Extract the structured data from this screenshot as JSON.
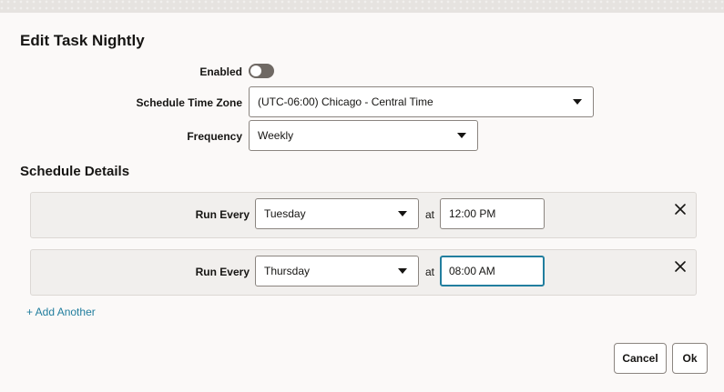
{
  "dialog": {
    "title": "Edit Task Nightly"
  },
  "form": {
    "enabled_label": "Enabled",
    "enabled_value": false,
    "timezone_label": "Schedule Time Zone",
    "timezone_value": "(UTC-06:00) Chicago - Central Time",
    "frequency_label": "Frequency",
    "frequency_value": "Weekly"
  },
  "schedule": {
    "title": "Schedule Details",
    "rows": [
      {
        "label": "Run Every",
        "day": "Tuesday",
        "at": "at",
        "time": "12:00 PM"
      },
      {
        "label": "Run Every",
        "day": "Thursday",
        "at": "at",
        "time": "08:00 AM"
      }
    ],
    "add_label": "+ Add Another"
  },
  "buttons": {
    "cancel": "Cancel",
    "ok": "Ok"
  },
  "icons": {
    "dropdown": "chevron-down-icon",
    "remove": "close-icon"
  },
  "colors": {
    "accent": "#227e9e",
    "toggle_off": "#6f6964",
    "row_background": "#f1efed"
  }
}
